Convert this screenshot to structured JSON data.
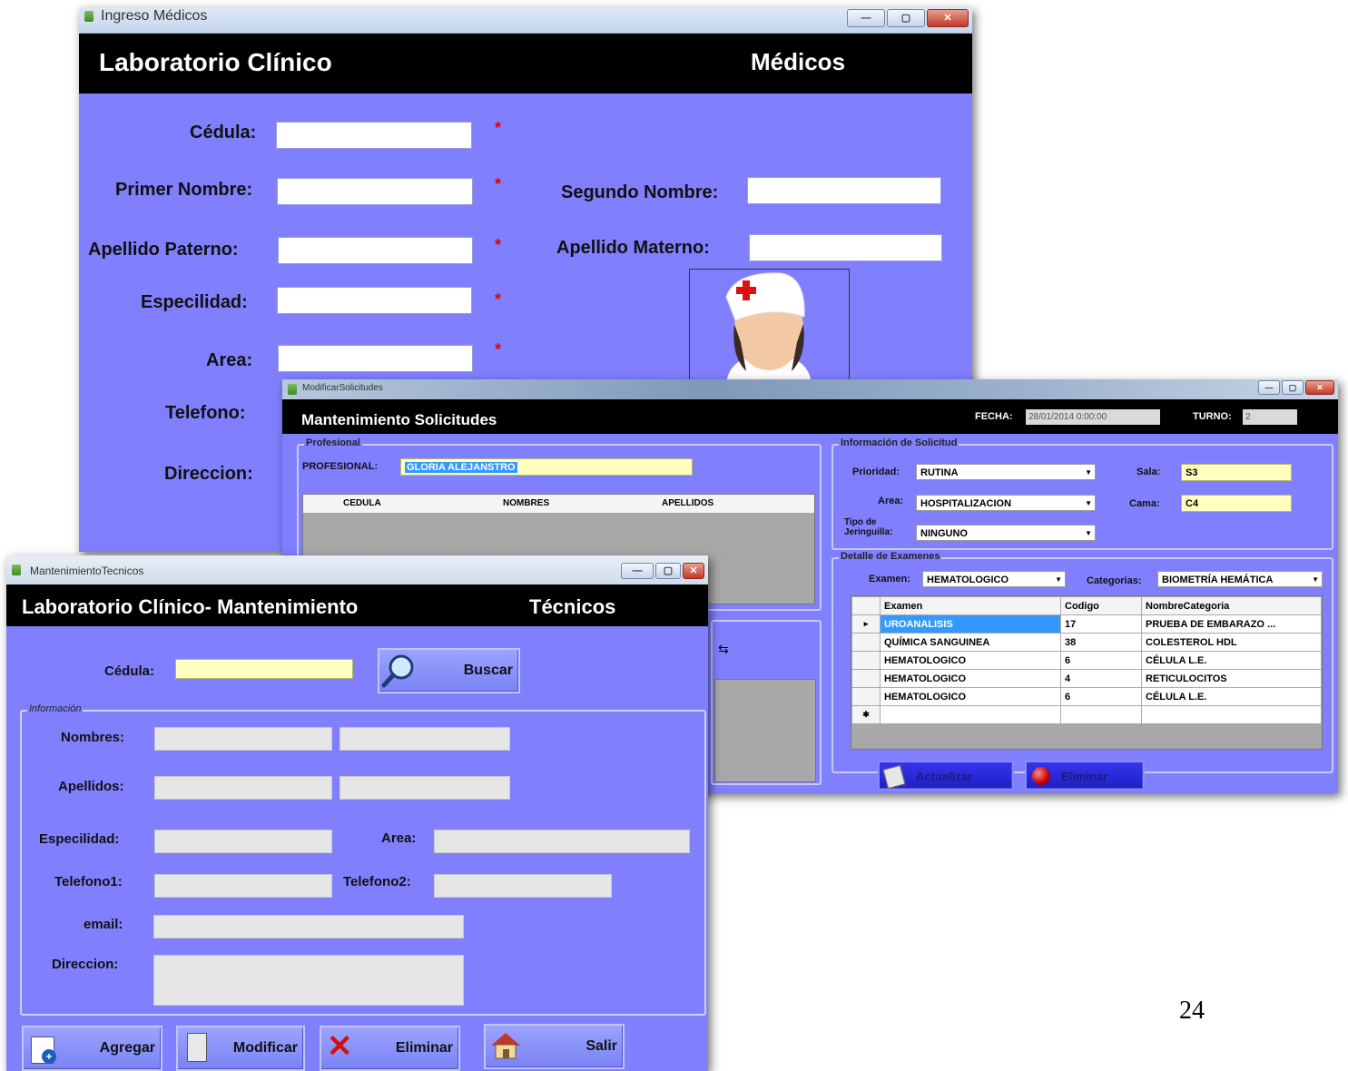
{
  "medicos_window": {
    "title": "Ingreso  Médicos",
    "header_left": "Laboratorio Clínico",
    "header_right": "Médicos",
    "labels": {
      "cedula": "Cédula:",
      "primer_nombre": "Primer Nombre:",
      "segundo_nombre": "Segundo Nombre:",
      "apellido_paterno": "Apellido Paterno:",
      "apellido_materno": "Apellido Materno:",
      "especialidad": "Especilidad:",
      "area": "Area:",
      "telefono": "Telefono:",
      "direccion": "Direccion:"
    },
    "required_mark": "*",
    "photo_icon": "nurse-avatar-icon"
  },
  "solicitudes_window": {
    "title": "ModificarSolicitudes",
    "header_title": "Mantenimiento Solicitudes",
    "fecha_label": "FECHA:",
    "fecha_value": "28/01/2014 0:00:00",
    "turno_label": "TURNO:",
    "turno_value": "2",
    "profesional_group": "Profesional",
    "profesional_label": "PROFESIONAL:",
    "profesional_value": "GLORIA ALEJANSTRO",
    "prof_columns": [
      "CEDULA",
      "NOMBRES",
      "APELLIDOS"
    ],
    "info_group": "Información de Solicitud",
    "prioridad_label": "Prioridad:",
    "prioridad_value": "RUTINA",
    "sala_label": "Sala:",
    "sala_value": "S3",
    "area_label": "Area:",
    "area_value": "HOSPITALIZACION",
    "cama_label": "Cama:",
    "cama_value": "C4",
    "jeringuilla_label": "Tipo de Jeringuilla:",
    "jeringuilla_value": "NINGUNO",
    "detalle_group": "Detalle de Examenes",
    "examen_label": "Examen:",
    "examen_value": "HEMATOLOGICO",
    "categorias_label": "Categorias:",
    "categorias_value": "BIOMETRÍA HEMÁTICA",
    "exam_columns": [
      "Examen",
      "Codigo",
      "NombreCategoria"
    ],
    "exam_rows": [
      {
        "examen": "UROANALISIS",
        "codigo": "17",
        "categoria": "PRUEBA DE EMBARAZO"
      },
      {
        "examen": "QUÍMICA SANGUINEA",
        "codigo": "38",
        "categoria": "COLESTEROL HDL"
      },
      {
        "examen": "HEMATOLOGICO",
        "codigo": "6",
        "categoria": "CÉLULA L.E."
      },
      {
        "examen": "HEMATOLOGICO",
        "codigo": "4",
        "categoria": "RETICULOCITOS"
      },
      {
        "examen": "HEMATOLOGICO",
        "codigo": "6",
        "categoria": "CÉLULA L.E."
      }
    ],
    "row_marker_current": "▸",
    "row_marker_new": "✱",
    "cell_ellipsis": "...",
    "btn1_label": "Actualizar",
    "btn2_label": "Eliminar"
  },
  "tecnicos_window": {
    "title": "MantenimientoTecnicos",
    "header_left": "Laboratorio Clínico- Mantenimiento",
    "header_right": "Técnicos",
    "cedula_label": "Cédula:",
    "cedula_value": "",
    "buscar_label": "Buscar",
    "info_group": "Información",
    "nombres_label": "Nombres:",
    "apellidos_label": "Apellidos:",
    "especialidad_label": "Especilidad:",
    "area_label": "Area:",
    "telefono1_label": "Telefono1:",
    "telefono2_label": "Telefono2:",
    "email_label": "email:",
    "direccion_label": "Direccion:",
    "agregar_label": "Agregar",
    "modificar_label": "Modificar",
    "eliminar_label": "Eliminar",
    "salir_label": "Salir"
  },
  "page_number": "24",
  "colors": {
    "form_bg": "#8080ff",
    "header_bg": "#000000",
    "required": "#e00000",
    "readonly_field": "#ffffc0",
    "selection": "#3399ff"
  }
}
